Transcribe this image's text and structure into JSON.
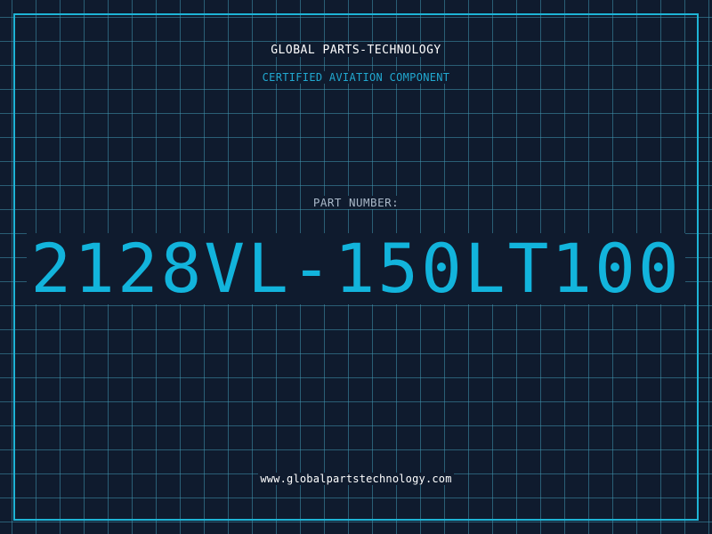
{
  "header": {
    "company": "GLOBAL PARTS-TECHNOLOGY",
    "subtitle": "CERTIFIED AVIATION COMPONENT"
  },
  "part": {
    "label": "PART NUMBER:",
    "number": "2128VL-150LT100"
  },
  "footer": {
    "url": "www.globalpartstechnology.com"
  },
  "colors": {
    "background": "#0f1b2e",
    "grid": "#4096af",
    "accent": "#1eb4d6",
    "part_number": "#12b4dc",
    "label": "#a9b8c8",
    "text": "#ffffff"
  }
}
